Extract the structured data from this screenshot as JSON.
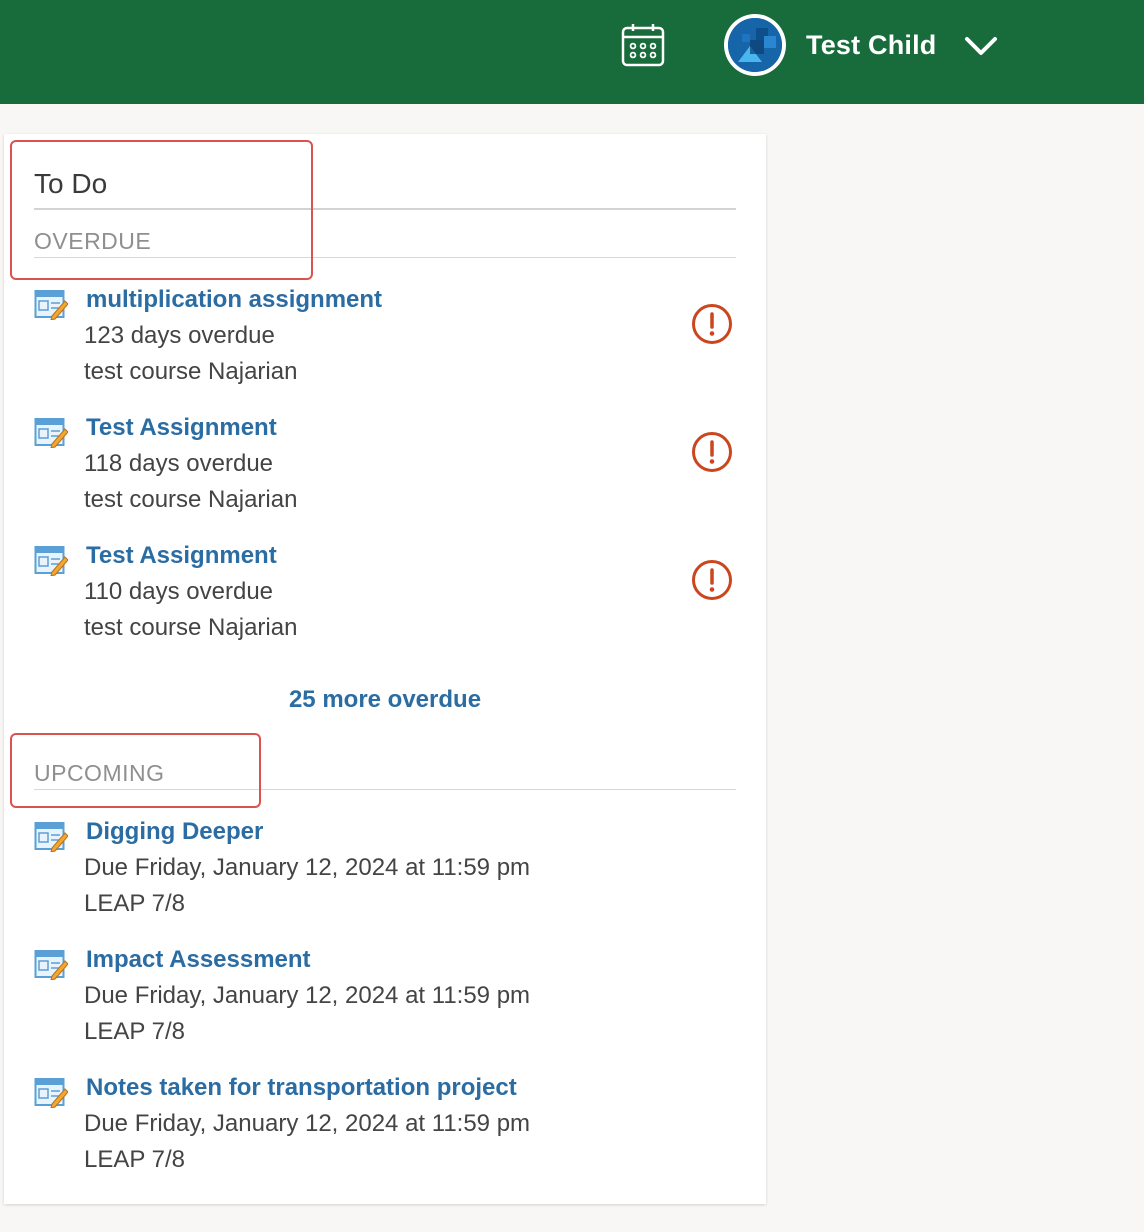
{
  "header": {
    "user_name": "Test Child",
    "calendar_icon": "calendar-icon",
    "dropdown_icon": "chevron-down-icon",
    "bar_color": "#186b3a"
  },
  "todo": {
    "title": "To Do",
    "overdue": {
      "label": "OVERDUE",
      "items": [
        {
          "title": "multiplication assignment",
          "status": "123 days overdue",
          "course": "test course Najarian"
        },
        {
          "title": "Test Assignment",
          "status": "118 days overdue",
          "course": "test course Najarian"
        },
        {
          "title": "Test Assignment",
          "status": "110 days overdue",
          "course": "test course Najarian"
        }
      ],
      "more_link": "25 more overdue"
    },
    "upcoming": {
      "label": "UPCOMING",
      "items": [
        {
          "title": "Digging Deeper",
          "due": "Due Friday, January 12, 2024 at 11:59 pm",
          "course": "LEAP 7/8"
        },
        {
          "title": "Impact Assessment",
          "due": "Due Friday, January 12, 2024 at 11:59 pm",
          "course": "LEAP 7/8"
        },
        {
          "title": "Notes taken for transportation project",
          "due": "Due Friday, January 12, 2024 at 11:59 pm",
          "course": "LEAP 7/8"
        }
      ]
    }
  },
  "colors": {
    "link": "#2b6ca3",
    "alert": "#c9461f",
    "highlight": "#d9534f"
  }
}
